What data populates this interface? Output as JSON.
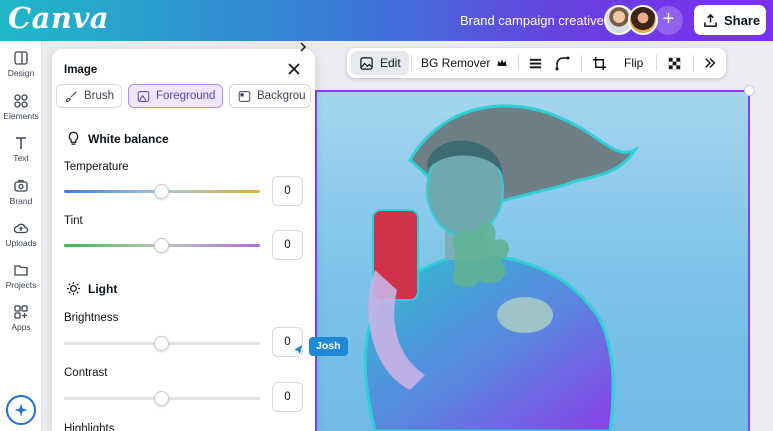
{
  "app": {
    "logo": "Canva"
  },
  "topbar": {
    "doc_title": "Brand campaign creative",
    "share_label": "Share",
    "add_label": "+"
  },
  "rail": {
    "items": [
      {
        "label": "Design",
        "icon": "layout-icon"
      },
      {
        "label": "Elements",
        "icon": "shapes-icon"
      },
      {
        "label": "Text",
        "icon": "text-icon"
      },
      {
        "label": "Brand",
        "icon": "brand-icon"
      },
      {
        "label": "Uploads",
        "icon": "cloud-upload-icon"
      },
      {
        "label": "Projects",
        "icon": "folder-icon"
      },
      {
        "label": "Apps",
        "icon": "apps-icon"
      }
    ]
  },
  "toolbar": {
    "edit_label": "Edit",
    "bg_remover_label": "BG Remover",
    "flip_label": "Flip"
  },
  "panel": {
    "title": "Image",
    "chips": [
      {
        "label": "Brush",
        "active": false
      },
      {
        "label": "Foreground",
        "active": true
      },
      {
        "label": "Backgrou",
        "active": false
      }
    ],
    "white_balance": {
      "heading": "White balance",
      "temperature": {
        "label": "Temperature",
        "value": "0"
      },
      "tint": {
        "label": "Tint",
        "value": "0"
      }
    },
    "light": {
      "heading": "Light",
      "brightness": {
        "label": "Brightness",
        "value": "0"
      },
      "contrast": {
        "label": "Contrast",
        "value": "0"
      },
      "highlights": {
        "label": "Highlights"
      }
    }
  },
  "collaborator_cursor": {
    "name": "Josh",
    "color": "#1e88d6"
  },
  "colors": {
    "accent": "#8b3dff",
    "active_chip_bg": "#efe8fd"
  }
}
